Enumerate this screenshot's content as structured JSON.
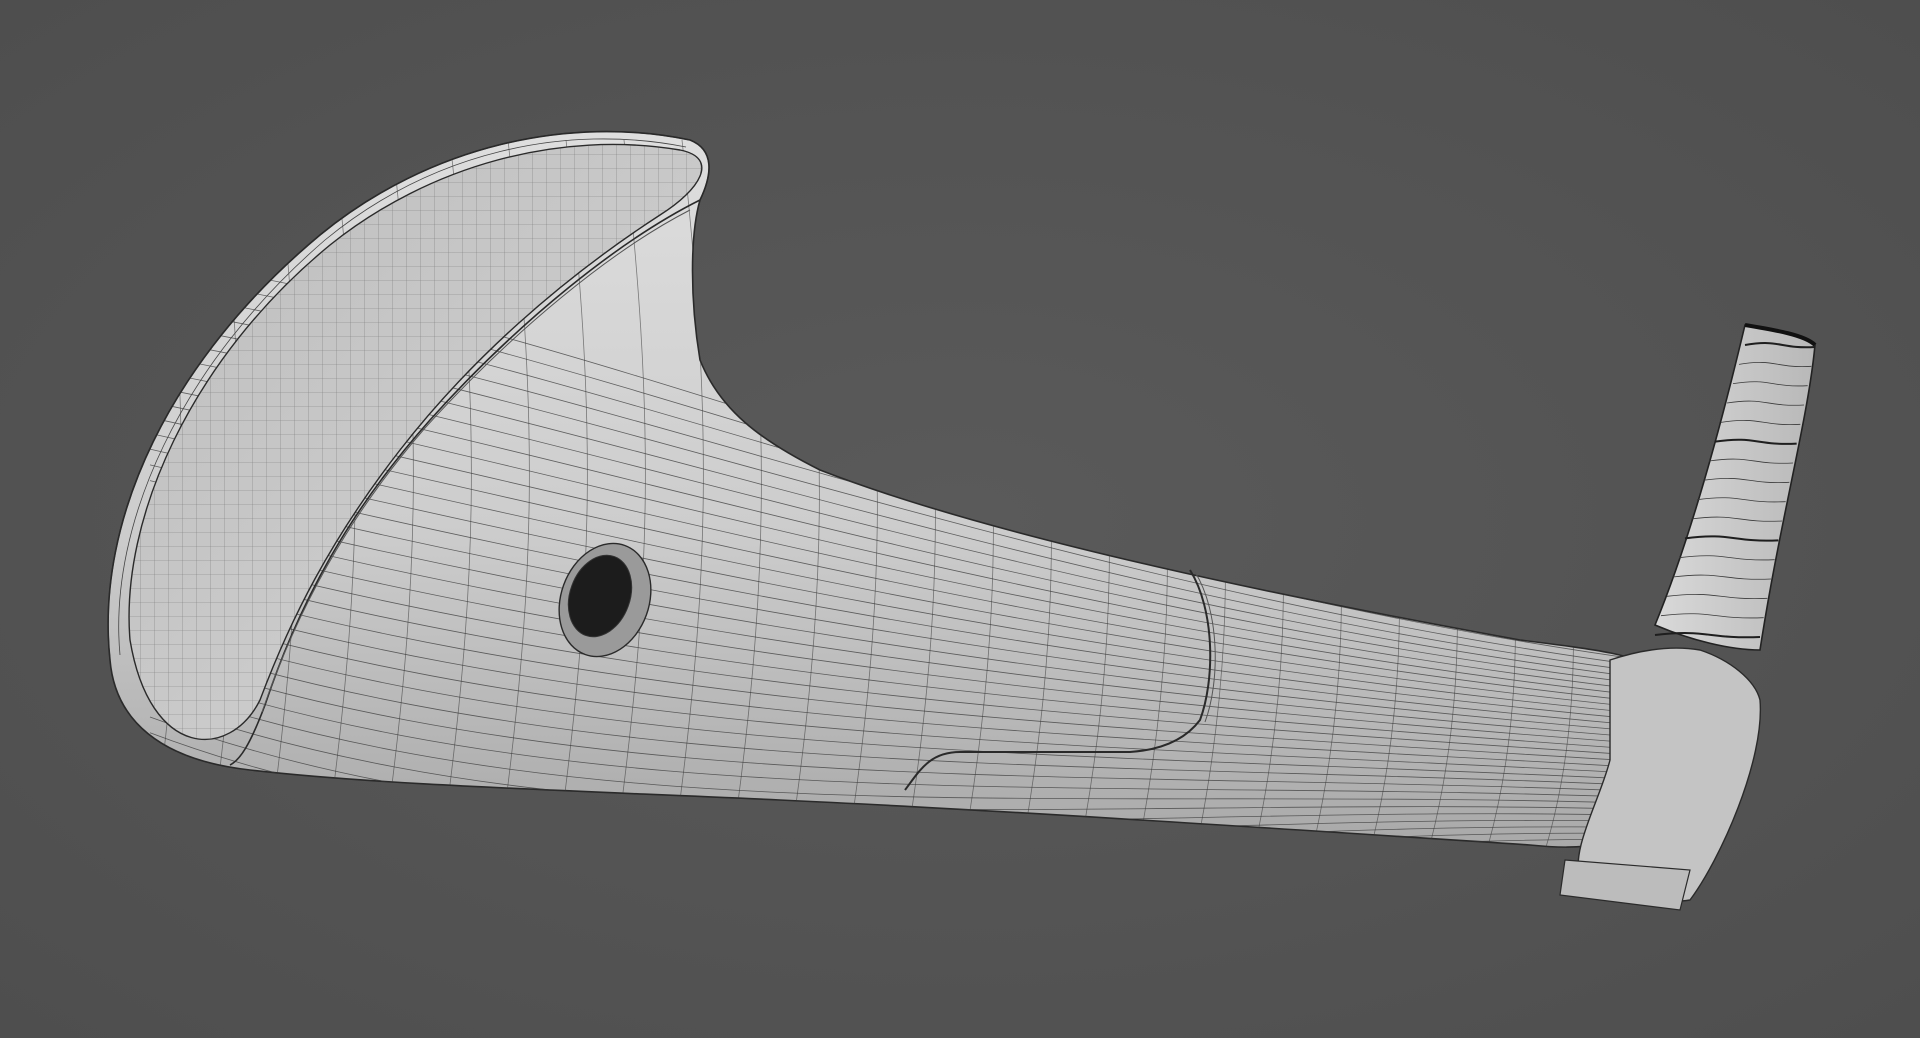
{
  "scene": {
    "background_color": "#545454",
    "object_base_color": "#c9c9c9",
    "object_light_color": "#e2e2e2",
    "object_shadow_color": "#9a9a9a",
    "wire_color": "#3a3a3a",
    "edge_color": "#1e1e1e",
    "view_mode": "wireframe-on-shaded"
  }
}
